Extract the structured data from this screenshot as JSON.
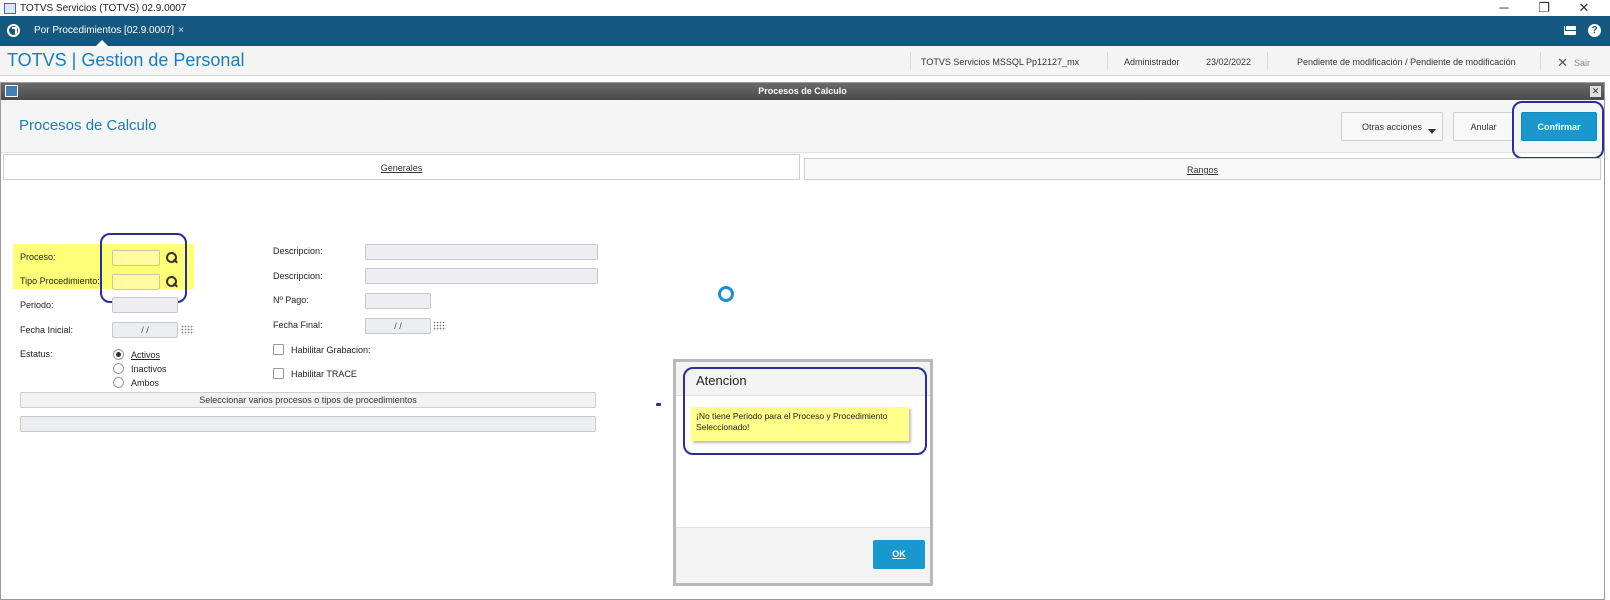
{
  "window": {
    "title": "TOTVS Servicios (TOTVS) 02.9.0007",
    "minimize": "─",
    "restore": "❐",
    "close": "✕"
  },
  "tabbar": {
    "tab_label": "Por Procedimientos [02.9.0007]",
    "tab_close": "×",
    "help": "?"
  },
  "header": {
    "brand": "TOTVS | Gestion de Personal",
    "server": "TOTVS Servicios MSSQL Pp12127_mx",
    "user": "Administrador",
    "date": "23/02/2022",
    "status": "Pendiente de modificación / Pendiente de modificación",
    "exit_label": "Sair",
    "exit_icon": "✕"
  },
  "dialog": {
    "title": "Procesos de Calculo",
    "close": "✕"
  },
  "page": {
    "heading": "Procesos de Calculo",
    "other_actions": "Otras acciones",
    "cancel": "Anular",
    "confirm": "Confirmar"
  },
  "tabs": {
    "general": "Generales",
    "ranges": "Rangos"
  },
  "form": {
    "proceso_label": "Proceso:",
    "tipo_label": "Tipo Procedimiento:",
    "periodo_label": "Periodo:",
    "fecha_inicial_label": "Fecha Inicial:",
    "fecha_inicial_value": "/ /",
    "estatus_label": "Estatus:",
    "status_options": [
      "Activos",
      "Inactivos",
      "Ambos"
    ],
    "desc1_label": "Descripcion:",
    "desc2_label": "Descripcion:",
    "npago_label": "Nº Pago:",
    "fecha_final_label": "Fecha Final:",
    "fecha_final_value": "/ /",
    "habilitar_grabacion": "Habilitar Grabacion:",
    "habilitar_trace": "Habilitar TRACE",
    "select_multiple": "Seleccionar varios procesos o tipos de procedimientos"
  },
  "alert": {
    "title": "Atencion",
    "message": "¡No tiene Periodo para el Proceso y Procedimiento Seleccionado!",
    "ok": "OK"
  },
  "colors": {
    "accent": "#1a98cd",
    "brand": "#1a7fb4",
    "tabbar": "#15587f",
    "highlight": "#ffff7a",
    "annotation": "#2b2f8f"
  }
}
